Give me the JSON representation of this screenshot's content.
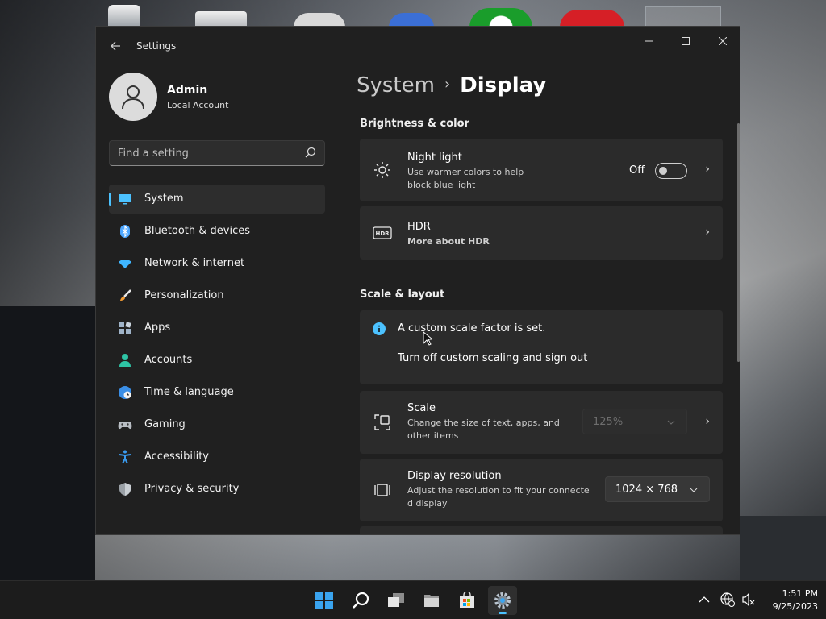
{
  "window": {
    "app_title": "Settings"
  },
  "user": {
    "name": "Admin",
    "type": "Local Account"
  },
  "search": {
    "placeholder": "Find a setting"
  },
  "sidebar": {
    "items": [
      {
        "label": "System",
        "icon": "monitor-icon"
      },
      {
        "label": "Bluetooth & devices",
        "icon": "bluetooth-icon"
      },
      {
        "label": "Network & internet",
        "icon": "wifi-icon"
      },
      {
        "label": "Personalization",
        "icon": "brush-icon"
      },
      {
        "label": "Apps",
        "icon": "apps-icon"
      },
      {
        "label": "Accounts",
        "icon": "person-icon"
      },
      {
        "label": "Time & language",
        "icon": "globe-clock-icon"
      },
      {
        "label": "Gaming",
        "icon": "controller-icon"
      },
      {
        "label": "Accessibility",
        "icon": "accessibility-icon"
      },
      {
        "label": "Privacy & security",
        "icon": "shield-icon"
      }
    ]
  },
  "breadcrumb": {
    "parent": "System",
    "current": "Display"
  },
  "brightness": {
    "heading": "Brightness & color",
    "night_light": {
      "title": "Night light",
      "desc": "Use warmer colors to help block blue light",
      "state": "Off"
    },
    "hdr": {
      "title": "HDR",
      "link": "More about HDR"
    }
  },
  "scale_layout": {
    "heading": "Scale & layout",
    "info": {
      "text": "A custom scale factor is set.",
      "link": "Turn off custom scaling and sign out"
    },
    "scale": {
      "title": "Scale",
      "desc": "Change the size of text, apps, and other items",
      "value": "125%"
    },
    "resolution": {
      "title": "Display resolution",
      "desc": "Adjust the resolution to fit your connecte d display",
      "value": "1024 × 768"
    }
  },
  "taskbar": {
    "apps": [
      "start-icon",
      "search-icon",
      "task-view-icon",
      "file-explorer-icon",
      "store-icon",
      "settings-gear-icon"
    ],
    "time": "1:51 PM",
    "date": "9/25/2023"
  },
  "colors": {
    "accent": "#4cc2ff",
    "link": "#99ebff",
    "window_bg": "#202020",
    "card_bg": "#2b2b2b"
  }
}
